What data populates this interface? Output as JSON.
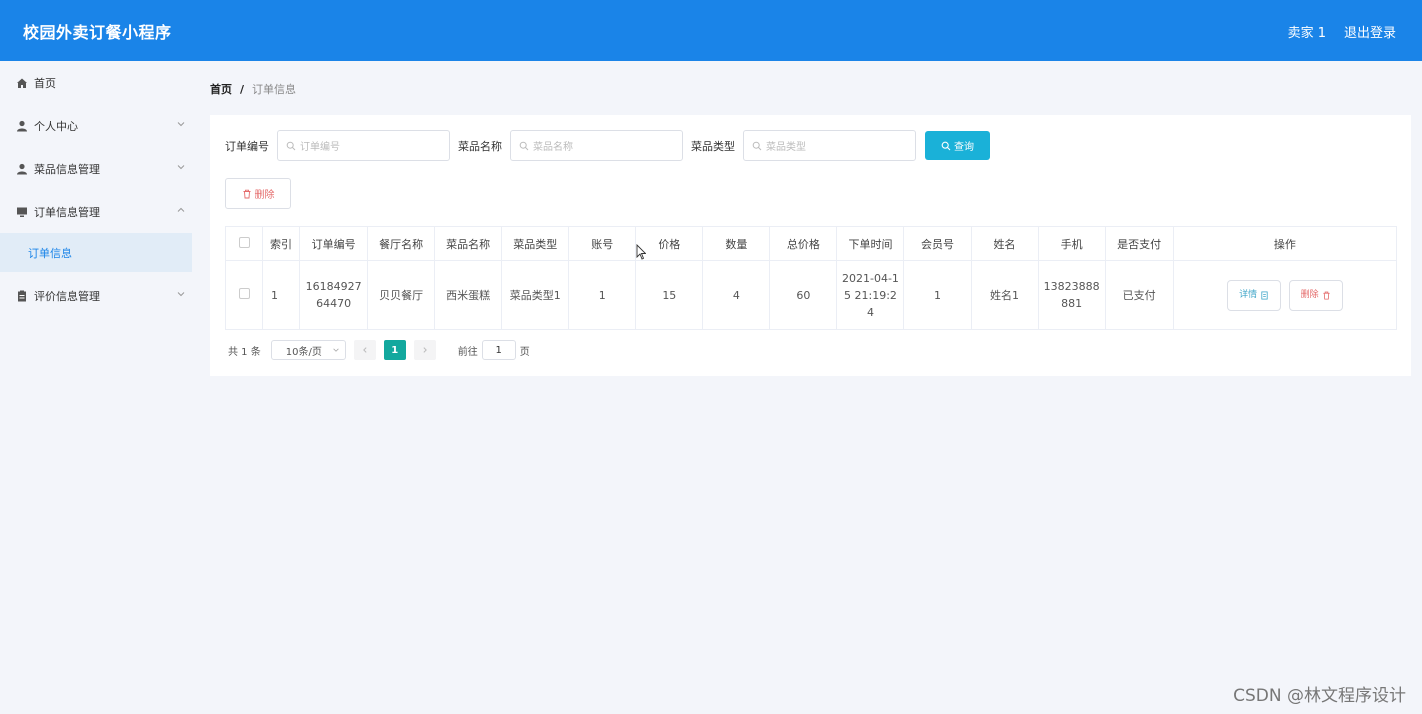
{
  "header": {
    "app_title": "校园外卖订餐小程序",
    "user": "卖家 1",
    "logout": "退出登录"
  },
  "sidebar": {
    "items": [
      {
        "label": "首页",
        "icon": "home-icon"
      },
      {
        "label": "个人中心",
        "icon": "user-icon"
      },
      {
        "label": "菜品信息管理",
        "icon": "user-icon"
      },
      {
        "label": "订单信息管理",
        "icon": "monitor-icon"
      },
      {
        "label": "评价信息管理",
        "icon": "clipboard-icon"
      }
    ],
    "sub_item": "订单信息"
  },
  "breadcrumb": {
    "home": "首页",
    "sep": "/",
    "current": "订单信息"
  },
  "search": {
    "order_no_label": "订单编号",
    "order_no_placeholder": "订单编号",
    "dish_name_label": "菜品名称",
    "dish_name_placeholder": "菜品名称",
    "dish_type_label": "菜品类型",
    "dish_type_placeholder": "菜品类型",
    "query_button": "查询"
  },
  "toolbar": {
    "delete_label": "删除"
  },
  "table": {
    "headers": [
      "索引",
      "订单编号",
      "餐厅名称",
      "菜品名称",
      "菜品类型",
      "账号",
      "价格",
      "数量",
      "总价格",
      "下单时间",
      "会员号",
      "姓名",
      "手机",
      "是否支付",
      "操作"
    ],
    "rows": [
      {
        "index": "1",
        "order_no": "1618492764470",
        "restaurant": "贝贝餐厅",
        "dish_name": "西米蛋糕",
        "dish_type": "菜品类型1",
        "account": "1",
        "price": "15",
        "quantity": "4",
        "total": "60",
        "order_time": "2021-04-15 21:19:24",
        "member_no": "1",
        "name": "姓名1",
        "phone": "13823888881",
        "paid": "已支付",
        "detail_label": "详情",
        "delete_label": "删除"
      }
    ]
  },
  "pagination": {
    "total": "共 1 条",
    "page_size": "10条/页",
    "current_page": "1",
    "goto_prefix": "前往",
    "goto_value": "1",
    "goto_suffix": "页"
  },
  "watermark": "CSDN @林文程序设计",
  "colors": {
    "header": "#1a84e8",
    "query_button": "#1ab1d8",
    "current_page": "#13a89e",
    "delete": "#e46a6a"
  }
}
